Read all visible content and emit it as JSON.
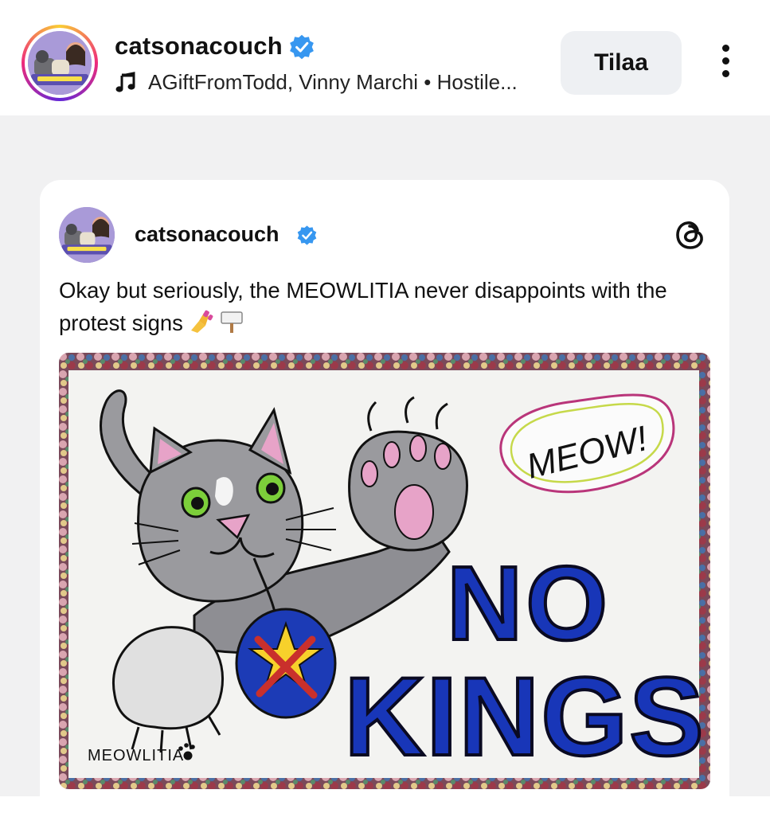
{
  "header": {
    "username": "catsonacouch",
    "music_info": "AGiftFromTodd, Vinny Marchi • Hostile...",
    "subscribe_label": "Tilaa",
    "avatar_icon": "profile-avatar"
  },
  "post": {
    "username": "catsonacouch",
    "text": "Okay but seriously, the MEOWLITIA never disappoints with the protest signs",
    "emojis": [
      "nail-polish-emoji",
      "placard-emoji"
    ],
    "platform_icon": "threads-icon",
    "image": {
      "speech_bubble": "MEOW!",
      "headline_top": "NO",
      "headline_bottom": "KINGS",
      "signature": "MEOWLITIA"
    }
  },
  "colors": {
    "verified": "#3797f0",
    "background": "#f1f1f2",
    "button_bg": "#eef0f3",
    "sign_blue": "#1836b8"
  }
}
